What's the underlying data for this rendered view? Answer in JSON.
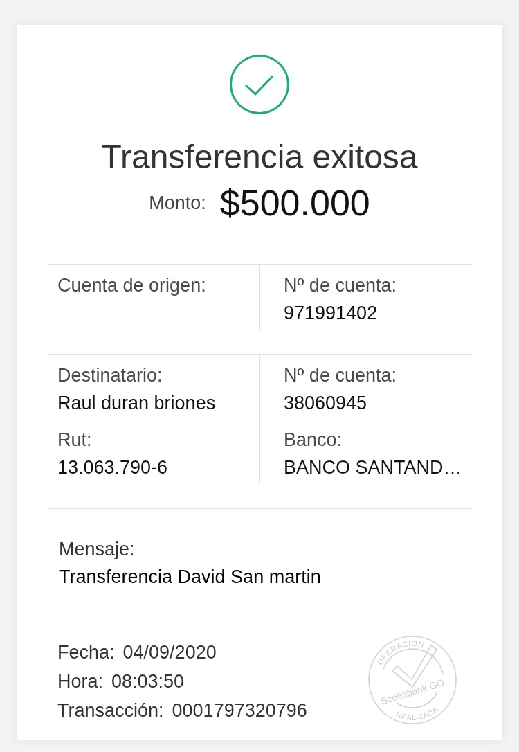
{
  "header": {
    "title": "Transferencia exitosa",
    "amount_label": "Monto:",
    "amount": "$500.000"
  },
  "sections": [
    {
      "columns": [
        {
          "fields": [
            {
              "label": "Cuenta de origen:"
            }
          ]
        },
        {
          "fields": [
            {
              "label": "Nº de cuenta:",
              "value": "971991402"
            }
          ]
        }
      ]
    },
    {
      "columns": [
        {
          "fields": [
            {
              "label": "Destinatario:",
              "value": "Raul duran briones"
            },
            {
              "label": "Rut:",
              "value": "13.063.790-6"
            }
          ]
        },
        {
          "fields": [
            {
              "label": "Nº de cuenta:",
              "value": "38060945"
            },
            {
              "label": "Banco:",
              "value": "BANCO SANTAND…"
            }
          ]
        }
      ]
    }
  ],
  "message": {
    "label": "Mensaje:",
    "value": "Transferencia David San martin"
  },
  "details": [
    {
      "label": "Fecha:",
      "value": "04/09/2020"
    },
    {
      "label": "Hora:",
      "value": "08:03:50"
    },
    {
      "label": "Transacción:",
      "value": "0001797320796"
    }
  ],
  "stamp": {
    "top": "OPERACIÓN",
    "middle": "Scotiabank GO",
    "bottom": "REALIZADA"
  }
}
